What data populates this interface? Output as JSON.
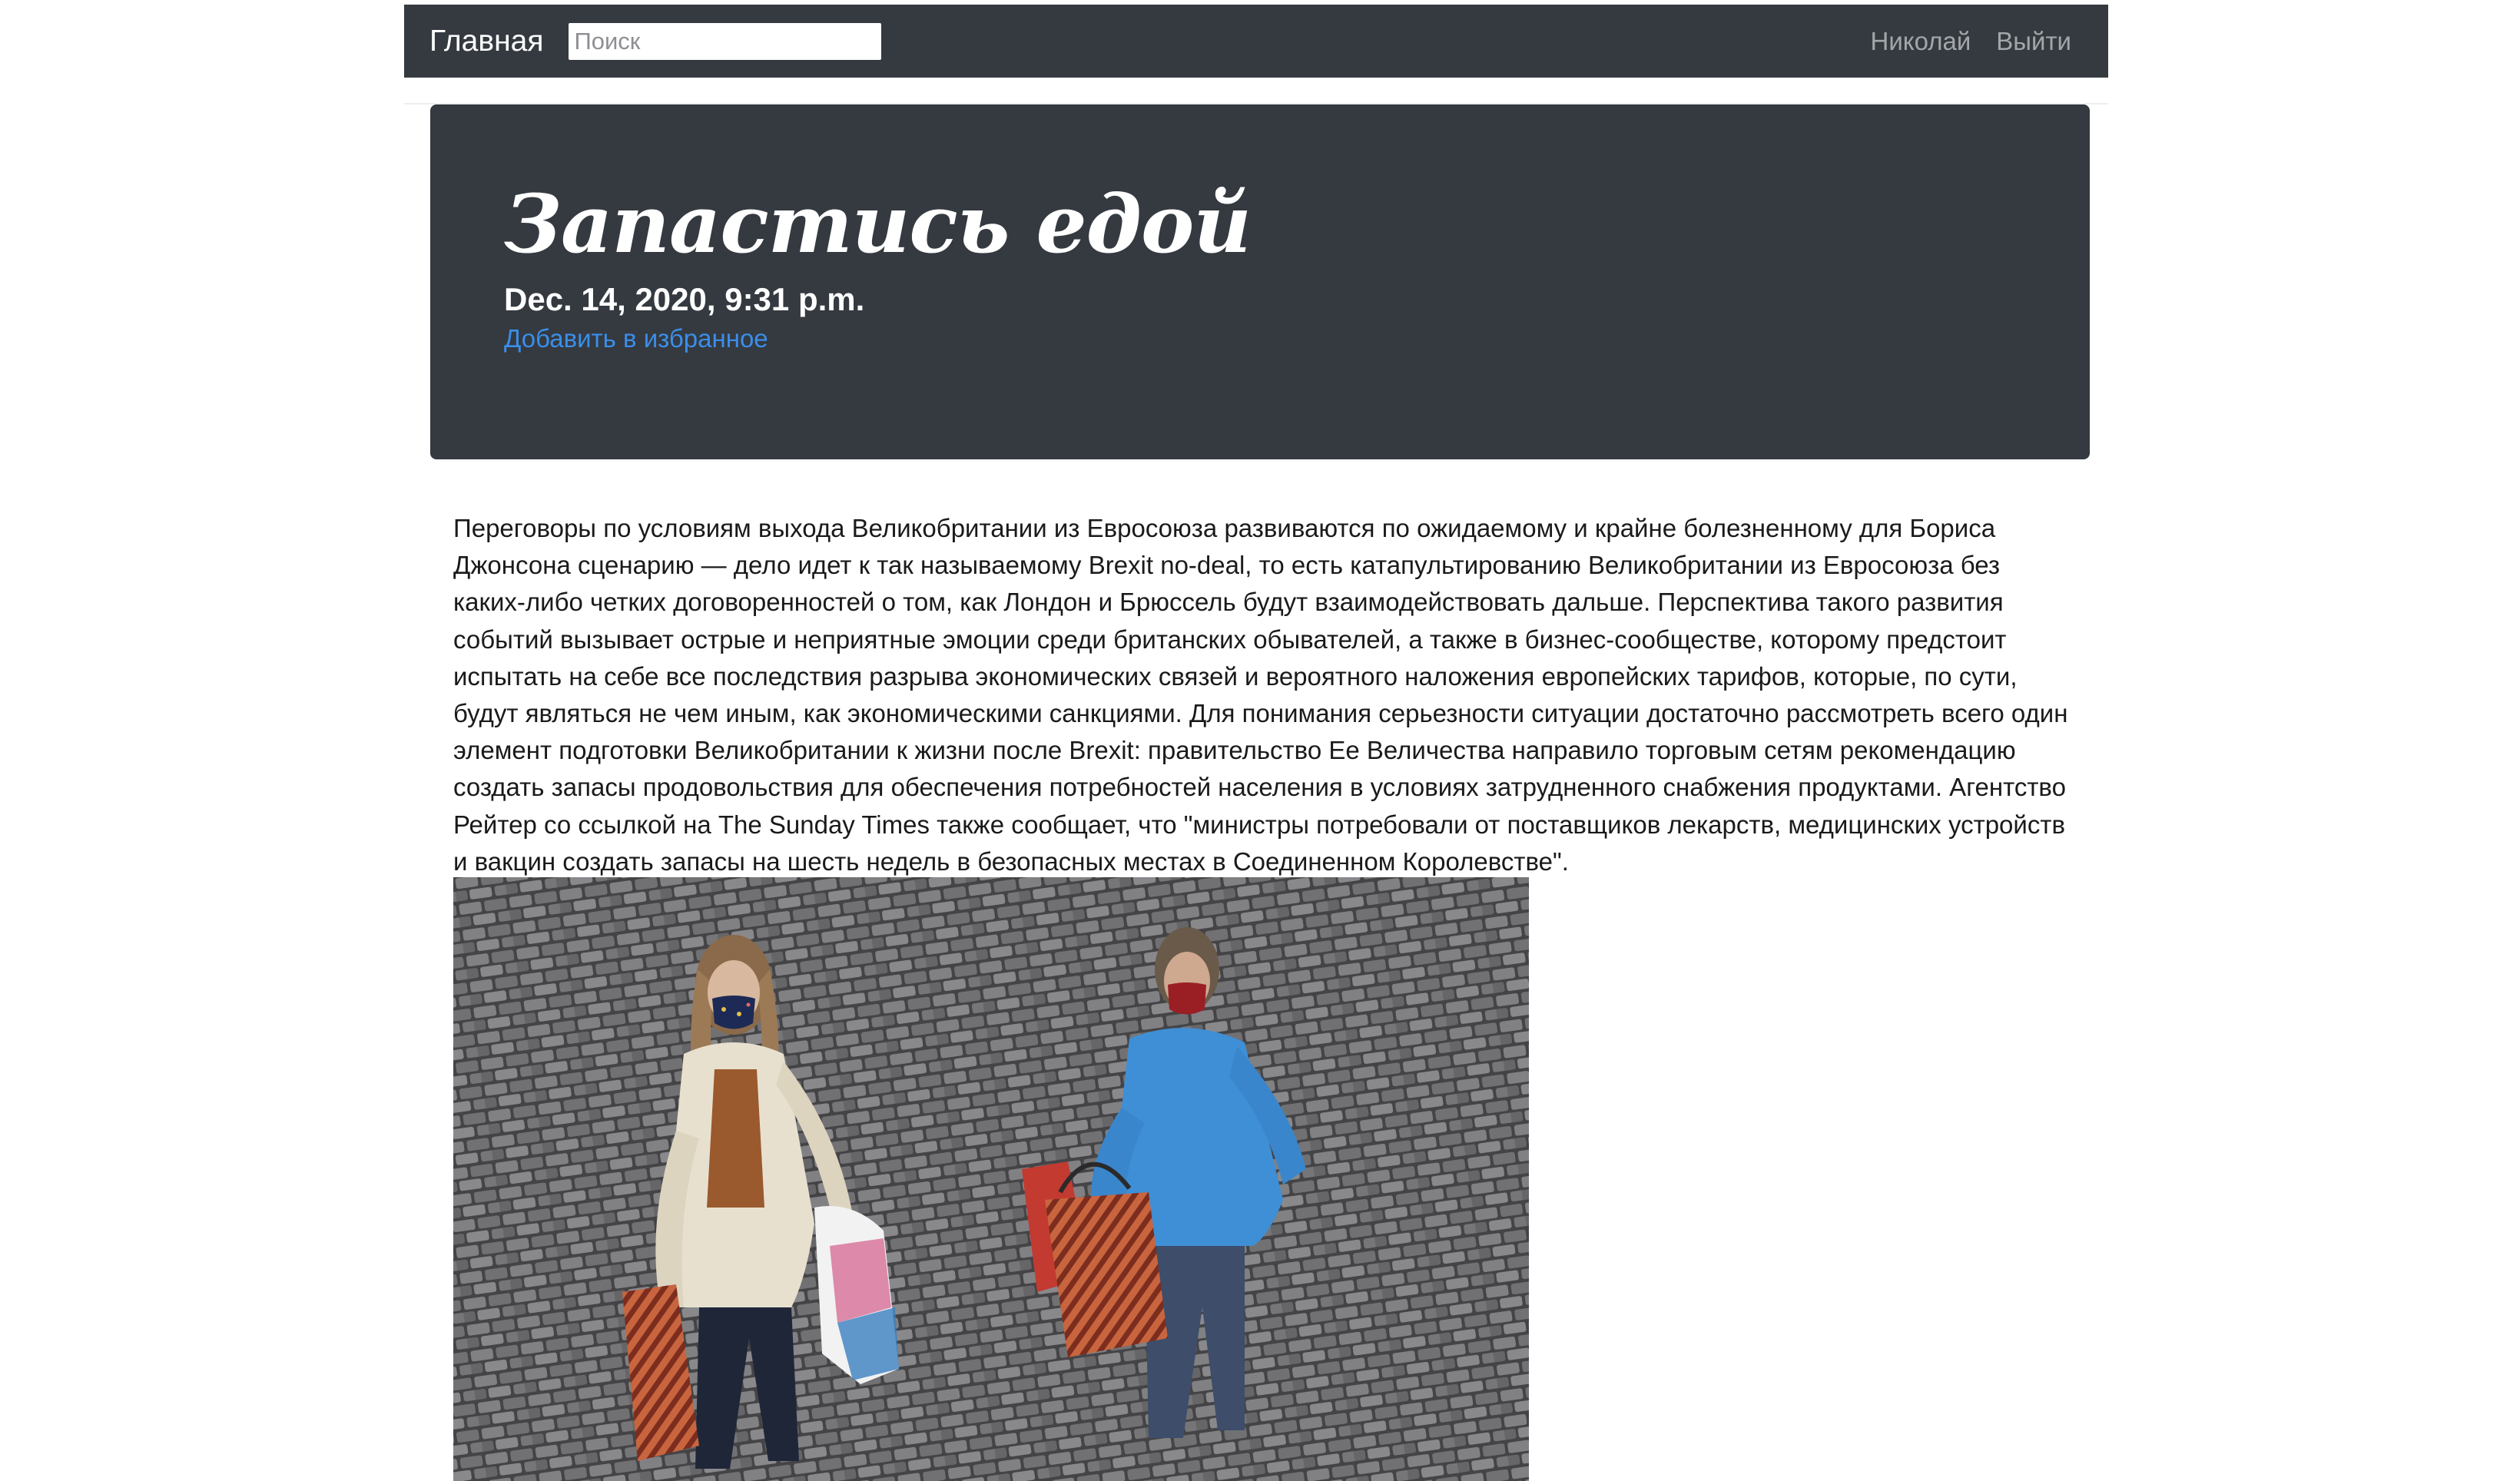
{
  "navbar": {
    "brand": "Главная",
    "search_placeholder": "Поиск",
    "user_name": "Николай",
    "logout": "Выйти"
  },
  "article": {
    "title": "Запастись едой",
    "date": "Dec. 14, 2020, 9:31 p.m.",
    "favorite_link": "Добавить в избранное",
    "body": "Переговоры по условиям выхода Великобритании из Евросоюза развиваются по ожидаемому и крайне болезненному для Бориса Джонсона сценарию — дело идет к так называемому Brexit no-deal, то есть катапультированию Великобритании из Евросоюза без каких-либо четких договоренностей о том, как Лондон и Брюссель будут взаимодействовать дальше. Перспектива такого развития событий вызывает острые и неприятные эмоции среди британских обывателей, а также в бизнес-сообществе, которому предстоит испытать на себе все последствия разрыва экономических связей и вероятного наложения европейских тарифов, которые, по сути, будут являться не чем иным, как экономическими санкциями. Для понимания серьезности ситуации достаточно рассмотреть всего один элемент подготовки Великобритании к жизни после Brexit: правительство Ее Величества направило торговым сетям рекомендацию создать запасы продовольствия для обеспечения потребностей населения в условиях затрудненного снабжения продуктами. Агентство Рейтер со ссылкой на The Sunday Times также сообщает, что \"министры потребовали от поставщиков лекарств, медицинских устройств и вакцин создать запасы на шесть недель в безопасных местах в Соединенном Королевстве\"."
  },
  "colors": {
    "navbar_bg": "#343a40",
    "jumbotron_bg": "#343a40",
    "link": "#3b8eea"
  }
}
